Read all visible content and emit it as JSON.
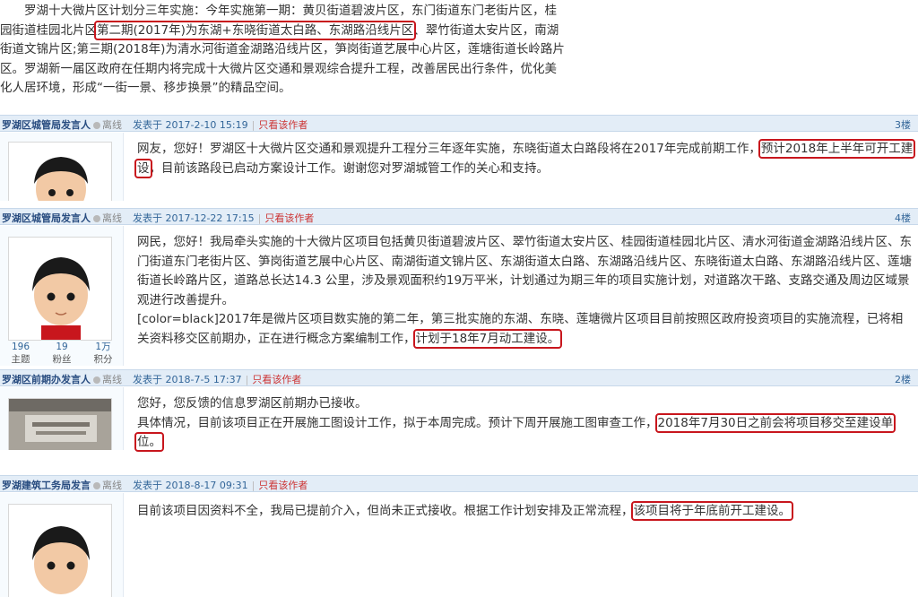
{
  "intro": {
    "part1": "罗湖十大微片区计划分三年实施：今年实施第一期：黄贝街道碧波片区，东门街道东门老街片区，桂园街道桂园北片区",
    "highlight": "第二期(2017年)为东湖+东晓街道太白路、东湖路沿线片区",
    "part2": "、翠竹街道太安片区，南湖街道文锦片区;第三期(2018年)为清水河街道金湖路沿线片区，笋岗街道艺展中心片区，莲塘街道长岭路片区。罗湖新一届区政府在任期内将完成十大微片区交通和景观综合提升工程，改善居民出行条件，优化美化人居环境，形成“一街一景、移步换景”的精品空间。"
  },
  "posts": [
    {
      "author": "罗湖区城管局发言人",
      "status": "离线",
      "posted": "发表于 2017-2-10 15:19",
      "only_author": "只看该作者",
      "floor": "3楼",
      "text_before": "网友，您好！罗湖区十大微片区交通和景观提升工程分三年逐年实施，东晓街道太白路段将在2017年完成前期工作，",
      "highlight": "预计2018年上半年可开工建",
      "text_after_line2_hl": "设",
      "text_after": "，目前该路段已启动方案设计工作。谢谢您对罗湖城管工作的关心和支持。"
    },
    {
      "author": "罗湖区城管局发言人",
      "status": "离线",
      "posted": "发表于 2017-12-22 17:15",
      "only_author": "只看该作者",
      "floor": "4楼",
      "text_main": "网民，您好！我局牵头实施的十大微片区项目包括黄贝街道碧波片区、翠竹街道太安片区、桂园街道桂园北片区、清水河街道金湖路沿线片区、东门街道东门老街片区、笋岗街道艺展中心片区、南湖街道文锦片区、东湖街道太白路、东湖路沿线片区、东晓街道太白路、东湖路沿线片区、莲塘街道长岭路片区，道路总长达14.3 公里，涉及景观面积约19万平米，计划通过为期三年的项目实施计划，对道路次干路、支路交通及周边区域景观进行改善提升。",
      "text_color": "[color=black]2017年是微片区项目数实施的第二年，第三批实施的东湖、东晓、莲塘微片区项目目前按照区政府投资项目的实施流程，已将相关资料移交区前期办，正在进行概念方案编制工作，",
      "highlight": "计划于18年7月动工建设。",
      "stats": [
        {
          "value": "196",
          "label": "主题"
        },
        {
          "value": "19",
          "label": "粉丝"
        },
        {
          "value": "1万",
          "label": "积分"
        }
      ]
    },
    {
      "author": "罗湖区前期办发言人",
      "status": "离线",
      "posted": "发表于 2018-7-5 17:37",
      "only_author": "只看该作者",
      "floor": "2楼",
      "line1": "您好，您反馈的信息罗湖区前期办已接收。",
      "line2_before": "具体情况，目前该项目正在开展施工图设计工作，拟于本周完成。预计下周开展施工图审查工作，",
      "highlight": "2018年7月30日之前会将项目移交至建设单位。"
    },
    {
      "author": "罗湖建筑工务局发言",
      "status": "离线",
      "posted": "发表于 2018-8-17 09:31",
      "only_author": "只看该作者",
      "text_before": "目前该项目因资料不全，我局已提前介入，但尚未正式接收。根据工作计划安排及正常流程，",
      "highlight": "该项目将于年底前开工建设。"
    }
  ],
  "colors": {
    "highlight_border": "#c8161d",
    "header_bg": "#e3edf7",
    "link": "#336699"
  }
}
